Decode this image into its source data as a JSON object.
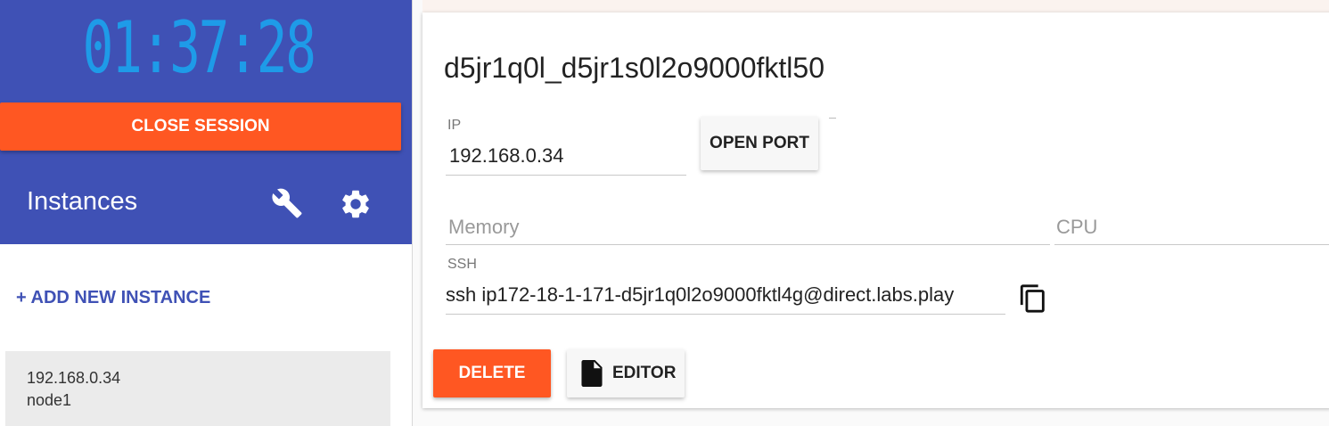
{
  "session": {
    "timer": "01:37:28",
    "close_label": "CLOSE SESSION"
  },
  "sidebar": {
    "title": "Instances",
    "add_label": "+ ADD NEW INSTANCE",
    "instances": [
      {
        "ip": "192.168.0.34",
        "name": "node1"
      }
    ]
  },
  "instance": {
    "title": "d5jr1q0l_d5jr1s0l2o9000fktl50",
    "ip_label": "IP",
    "ip_value": "192.168.0.34",
    "open_port_label": "OPEN PORT",
    "memory_placeholder": "Memory",
    "cpu_placeholder": "CPU",
    "ssh_label": "SSH",
    "ssh_value": "ssh ip172-18-1-171-d5jr1q0l2o9000fktl4g@direct.labs.play",
    "delete_label": "DELETE",
    "editor_label": "EDITOR"
  },
  "colors": {
    "primary": "#3f51b5",
    "accent": "#ff5722",
    "timer": "#1e9be8"
  },
  "icons": [
    "wrench-icon",
    "gear-icon",
    "copy-icon",
    "file-icon"
  ]
}
